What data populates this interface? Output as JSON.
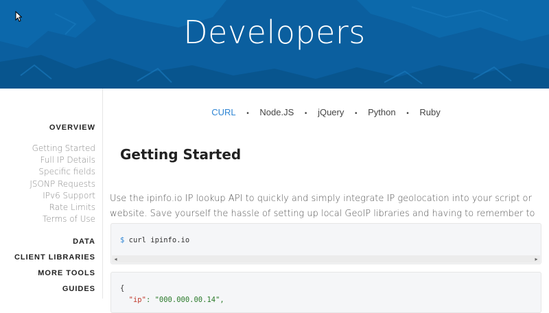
{
  "hero": {
    "title": "Developers"
  },
  "sidebar": {
    "overview": "OVERVIEW",
    "links": [
      "Getting Started",
      "Full IP Details",
      "Specific fields",
      "JSONP Requests",
      "IPv6 Support",
      "Rate Limits",
      "Terms of Use"
    ],
    "sections": [
      "DATA",
      "CLIENT LIBRARIES",
      "MORE TOOLS",
      "GUIDES"
    ]
  },
  "lang_nav": {
    "items": [
      "CURL",
      "Node.JS",
      "jQuery",
      "Python",
      "Ruby"
    ],
    "active": "CURL",
    "separator": "•"
  },
  "main": {
    "heading": "Getting Started",
    "intro": "Use the ipinfo.io IP lookup API to quickly and simply integrate IP geolocation into your script or website. Save yourself the hassle of setting up local GeoIP libraries and having to remember to regularly update the data.",
    "code1": {
      "prompt": "$",
      "command": "curl ipinfo.io"
    },
    "code2": {
      "line1": "{",
      "line2_key": "\"ip\"",
      "line2_value": ": \"000.000.00.14\","
    }
  },
  "colors": {
    "hero_blue": "#0a5f9e",
    "accent": "#2e85d4"
  }
}
